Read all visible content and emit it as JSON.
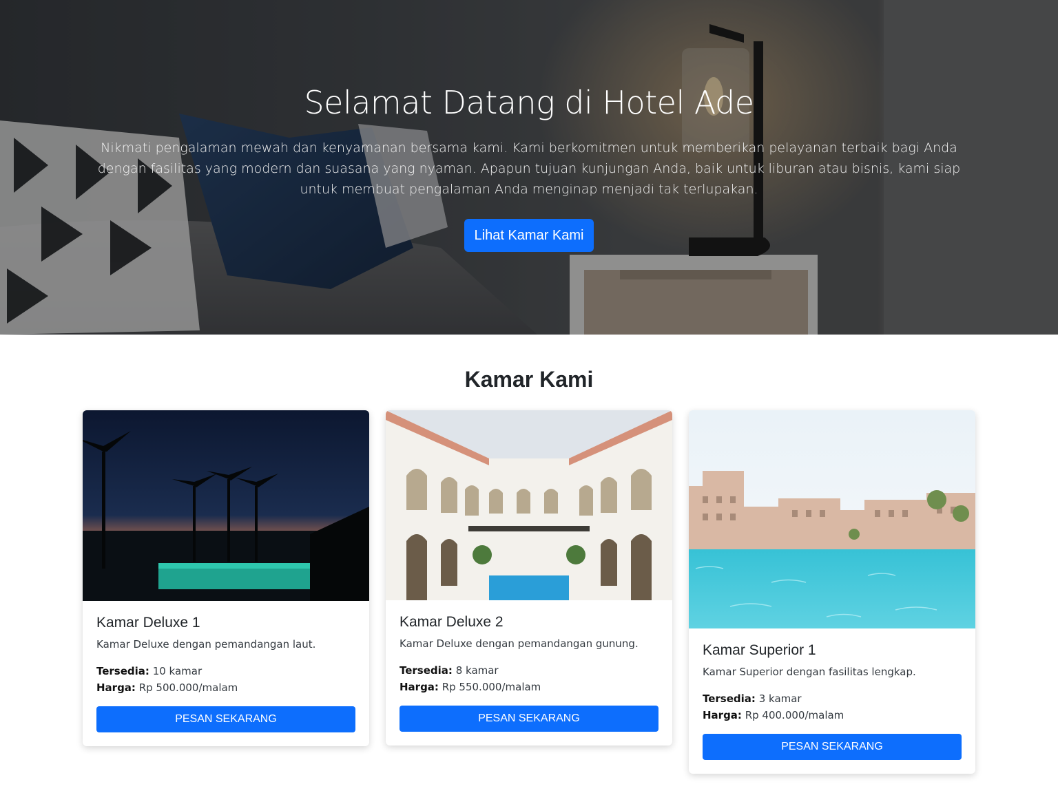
{
  "hero": {
    "title": "Selamat Datang di Hotel Ade",
    "description": "Nikmati pengalaman mewah dan kenyamanan bersama kami. Kami berkomitmen untuk memberikan pelayanan terbaik bagi Anda dengan fasilitas yang modern dan suasana yang nyaman. Apapun tujuan kunjungan Anda, baik untuk liburan atau bisnis, kami siap untuk membuat pengalaman Anda menginap menjadi tak terlupakan.",
    "button_label": "Lihat Kamar Kami"
  },
  "rooms_section": {
    "title": "Kamar Kami",
    "rooms": [
      {
        "name": "Kamar Deluxe 1",
        "description": "Kamar Deluxe dengan pemandangan laut.",
        "available_label": "Tersedia:",
        "available_value": "10 kamar",
        "price_label": "Harga:",
        "price_value": "Rp 500.000/malam",
        "button_label": "PESAN SEKARANG"
      },
      {
        "name": "Kamar Deluxe 2",
        "description": "Kamar Deluxe dengan pemandangan gunung.",
        "available_label": "Tersedia:",
        "available_value": "8 kamar",
        "price_label": "Harga:",
        "price_value": "Rp 550.000/malam",
        "button_label": "PESAN SEKARANG"
      },
      {
        "name": "Kamar Superior 1",
        "description": "Kamar Superior dengan fasilitas lengkap.",
        "available_label": "Tersedia:",
        "available_value": "3 kamar",
        "price_label": "Harga:",
        "price_value": "Rp 400.000/malam",
        "button_label": "PESAN SEKARANG"
      }
    ]
  },
  "colors": {
    "primary": "#0d6efd",
    "text": "#212529"
  }
}
